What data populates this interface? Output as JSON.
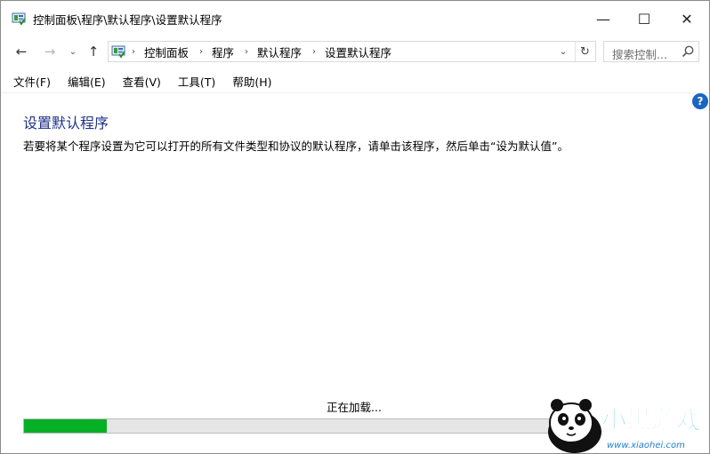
{
  "window": {
    "title": "控制面板\\程序\\默认程序\\设置默认程序",
    "minimize_glyph": "—",
    "maximize_glyph": "☐",
    "close_glyph": "✕"
  },
  "nav": {
    "back_glyph": "←",
    "forward_glyph": "→",
    "recent_glyph": "⌄",
    "up_glyph": "↑",
    "breadcrumbs": [
      "控制面板",
      "程序",
      "默认程序",
      "设置默认程序"
    ],
    "crumb_sep": "›",
    "dropdown_glyph": "⌄",
    "refresh_glyph": "↻",
    "search_placeholder": "搜索控制..."
  },
  "menu": [
    "文件(F)",
    "编辑(E)",
    "查看(V)",
    "工具(T)",
    "帮助(H)"
  ],
  "help_glyph": "?",
  "content": {
    "title": "设置默认程序",
    "description": "若要将某个程序设置为它可以打开的所有文件类型和协议的默认程序，请单击该程序，然后单击“设为默认值”。",
    "loading": "正在加载...",
    "progress": 0.155
  },
  "watermark": {
    "brand": "小黑游戏",
    "url": "www.xiaohei.com"
  },
  "colors": {
    "title_blue": "#1e3287",
    "progress_green": "#06b025",
    "help_blue": "#1a66c2"
  }
}
